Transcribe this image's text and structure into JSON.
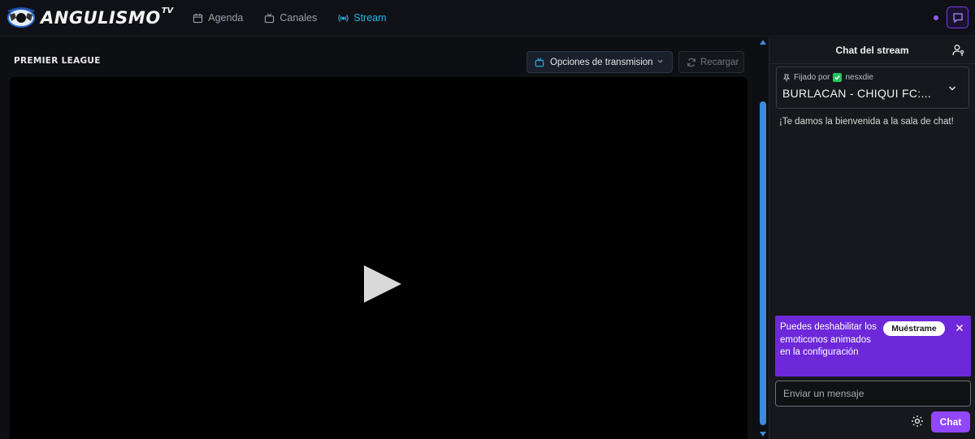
{
  "brand": {
    "name": "ANGULISMO",
    "suffix": "TV"
  },
  "nav": [
    {
      "label": "Agenda",
      "icon": "calendar-icon",
      "active": false
    },
    {
      "label": "Canales",
      "icon": "tv-icon",
      "active": false
    },
    {
      "label": "Stream",
      "icon": "broadcast-icon",
      "active": true
    }
  ],
  "main": {
    "league": "PREMIER LEAGUE",
    "options_label": "Opciones de transmision",
    "reload_label": "Recargar"
  },
  "chat": {
    "title": "Chat del stream",
    "pinned_by_label": "Fijado por",
    "pinned_user": "nesxdie",
    "pinned_message": "BURLACAN - CHIQUI FC:...",
    "welcome": "¡Te damos la bienvenida a la sala de chat!",
    "tip_text": "Puedes deshabilitar los emoticonos animados en la configuración",
    "tip_button": "Muéstrame",
    "input_placeholder": "Enviar un mensaje",
    "send_label": "Chat"
  },
  "colors": {
    "accent": "#22b7e8",
    "purple": "#9147ff",
    "tip_bg": "#6d28d9"
  }
}
